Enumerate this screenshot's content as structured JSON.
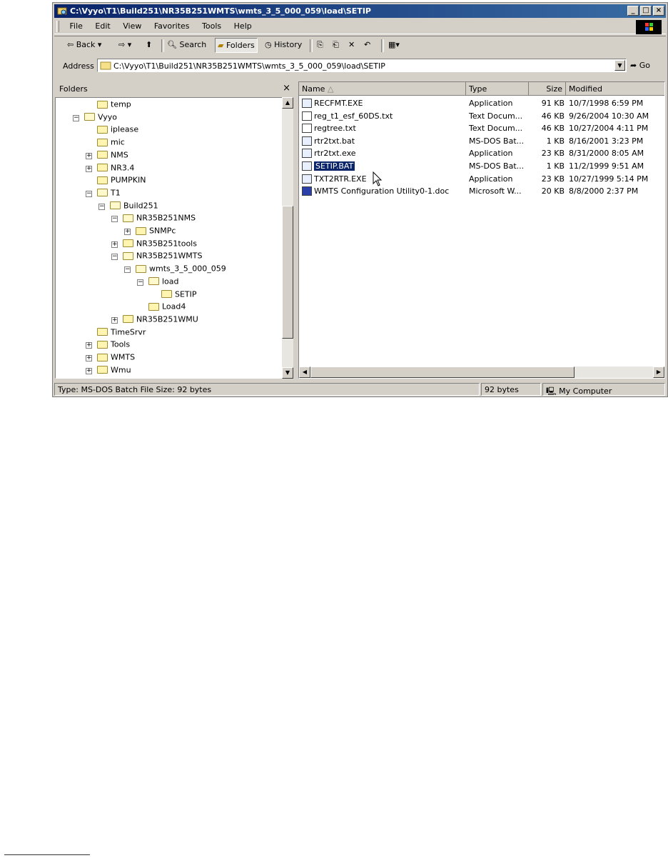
{
  "window": {
    "title": "C:\\Vyyo\\T1\\Build251\\NR35B251WMTS\\wmts_3_5_000_059\\load\\SETIP",
    "controls": {
      "minimize": "_",
      "maximize": "□",
      "close": "×"
    }
  },
  "menu": [
    "File",
    "Edit",
    "View",
    "Favorites",
    "Tools",
    "Help"
  ],
  "toolbar": {
    "back_label": "Back",
    "search_label": "Search",
    "folders_label": "Folders",
    "history_label": "History"
  },
  "address": {
    "label": "Address",
    "value": "C:\\Vyyo\\T1\\Build251\\NR35B251WMTS\\wmts_3_5_000_059\\load\\SETIP",
    "go_label": "Go"
  },
  "folders_pane": {
    "title": "Folders",
    "close": "×",
    "tree": [
      {
        "label": "temp",
        "level": 2,
        "expander": ""
      },
      {
        "label": "Vyyo",
        "level": 1,
        "expander": "−"
      },
      {
        "label": "iplease",
        "level": 2,
        "expander": ""
      },
      {
        "label": "mic",
        "level": 2,
        "expander": ""
      },
      {
        "label": "NMS",
        "level": 2,
        "expander": "+"
      },
      {
        "label": "NR3.4",
        "level": 2,
        "expander": "+"
      },
      {
        "label": "PUMPKIN",
        "level": 2,
        "expander": ""
      },
      {
        "label": "T1",
        "level": 2,
        "expander": "−"
      },
      {
        "label": "Build251",
        "level": 3,
        "expander": "−"
      },
      {
        "label": "NR35B251NMS",
        "level": 4,
        "expander": "−"
      },
      {
        "label": "SNMPc",
        "level": 5,
        "expander": "+"
      },
      {
        "label": "NR35B251tools",
        "level": 4,
        "expander": "+"
      },
      {
        "label": "NR35B251WMTS",
        "level": 4,
        "expander": "−"
      },
      {
        "label": "wmts_3_5_000_059",
        "level": 5,
        "expander": "−"
      },
      {
        "label": "load",
        "level": 6,
        "expander": "−"
      },
      {
        "label": "SETIP",
        "level": 7,
        "expander": ""
      },
      {
        "label": "Load4",
        "level": 6,
        "expander": ""
      },
      {
        "label": "NR35B251WMU",
        "level": 4,
        "expander": "+"
      },
      {
        "label": "TimeSrvr",
        "level": 2,
        "expander": ""
      },
      {
        "label": "Tools",
        "level": 2,
        "expander": "+"
      },
      {
        "label": "WMTS",
        "level": 2,
        "expander": "+"
      },
      {
        "label": "Wmu",
        "level": 2,
        "expander": "+"
      }
    ]
  },
  "file_list": {
    "columns": [
      "Name",
      "Type",
      "Size",
      "Modified"
    ],
    "rows": [
      {
        "name": "RECFMT.EXE",
        "type": "Application",
        "size": "91 KB",
        "modified": "10/7/1998 6:59 PM",
        "icon": "app"
      },
      {
        "name": "reg_t1_esf_60DS.txt",
        "type": "Text Docum...",
        "size": "46 KB",
        "modified": "9/26/2004 10:30 AM",
        "icon": "txt"
      },
      {
        "name": "regtree.txt",
        "type": "Text Docum...",
        "size": "46 KB",
        "modified": "10/27/2004 4:11 PM",
        "icon": "txt"
      },
      {
        "name": "rtr2txt.bat",
        "type": "MS-DOS Bat...",
        "size": "1 KB",
        "modified": "8/16/2001 3:23 PM",
        "icon": "bat"
      },
      {
        "name": "rtr2txt.exe",
        "type": "Application",
        "size": "23 KB",
        "modified": "8/31/2000 8:05 AM",
        "icon": "app"
      },
      {
        "name": "SETIP.BAT",
        "type": "MS-DOS Bat...",
        "size": "1 KB",
        "modified": "11/2/1999 9:51 AM",
        "icon": "bat",
        "selected": true
      },
      {
        "name": "TXT2RTR.EXE",
        "type": "Application",
        "size": "23 KB",
        "modified": "10/27/1999 5:14 PM",
        "icon": "app"
      },
      {
        "name": "WMTS Configuration Utility0-1.doc",
        "type": "Microsoft W...",
        "size": "20 KB",
        "modified": "8/8/2000 2:37 PM",
        "icon": "doc"
      }
    ]
  },
  "status": {
    "info": "Type: MS-DOS Batch File Size: 92 bytes",
    "size": "92 bytes",
    "zone": "My Computer"
  }
}
